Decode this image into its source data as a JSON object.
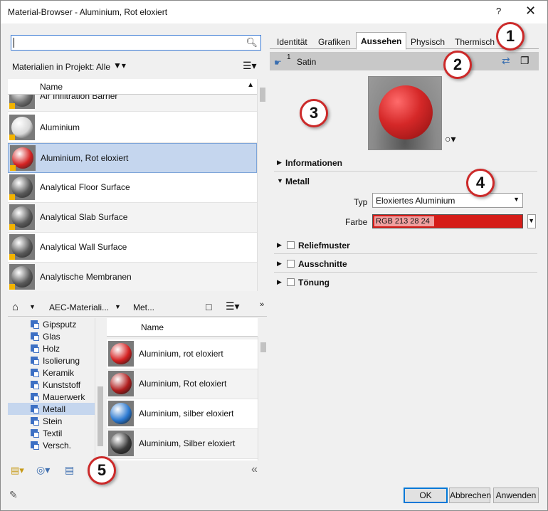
{
  "window": {
    "title": "Material-Browser - Aluminium, Rot eloxiert",
    "help": "?",
    "close": "✕"
  },
  "browser": {
    "search_value": "",
    "filter_label": "Materialien in Projekt: Alle",
    "list_header_name": "Name",
    "materials": [
      {
        "name": "Air Infiltration Barrier",
        "ball": "#6e6e6e"
      },
      {
        "name": "Aluminium",
        "ball": "#d7d7d7"
      },
      {
        "name": "Aluminium, Rot eloxiert",
        "ball": "#d42222"
      },
      {
        "name": "Analytical Floor Surface",
        "ball": "#5a5a5a"
      },
      {
        "name": "Analytical Slab Surface",
        "ball": "#5a5a5a"
      },
      {
        "name": "Analytical Wall Surface",
        "ball": "#5a5a5a"
      },
      {
        "name": "Analytische Membranen",
        "ball": "#5a5a5a"
      }
    ],
    "breadcrumb": [
      "AEC-Materiali...",
      "Met..."
    ],
    "tree": [
      "Gipsputz",
      "Glas",
      "Holz",
      "Isolierung",
      "Keramik",
      "Kunststoff",
      "Mauerwerk",
      "Metall",
      "Stein",
      "Textil",
      "Versch."
    ],
    "tree_selected": "Metall",
    "library_header_name": "Name",
    "library": [
      {
        "name": "Aluminium, rot eloxiert",
        "ball": "#d42222"
      },
      {
        "name": "Aluminium, Rot eloxiert",
        "ball": "#b01e1e"
      },
      {
        "name": "Aluminium, silber eloxiert",
        "ball": "#2a78d0"
      },
      {
        "name": "Aluminium, Silber eloxiert",
        "ball": "#3a3a3a"
      }
    ]
  },
  "editor": {
    "tabs": [
      "Identität",
      "Grafiken",
      "Aussehen",
      "Physisch",
      "Thermisch"
    ],
    "active_tab": "Aussehen",
    "asset_count": "1",
    "asset_name": "Satin",
    "sections": {
      "info": "Informationen",
      "metal": "Metall",
      "relief": "Reliefmuster",
      "cutouts": "Ausschnitte",
      "tint": "Tönung"
    },
    "type_label": "Typ",
    "type_value": "Eloxiertes Aluminium",
    "color_label": "Farbe",
    "color_value": "RGB 213 28 24",
    "color_hex": "#d51c18"
  },
  "buttons": {
    "ok": "OK",
    "cancel": "Abbrechen",
    "apply": "Anwenden"
  },
  "callouts": [
    "1",
    "2",
    "3",
    "4",
    "5"
  ]
}
